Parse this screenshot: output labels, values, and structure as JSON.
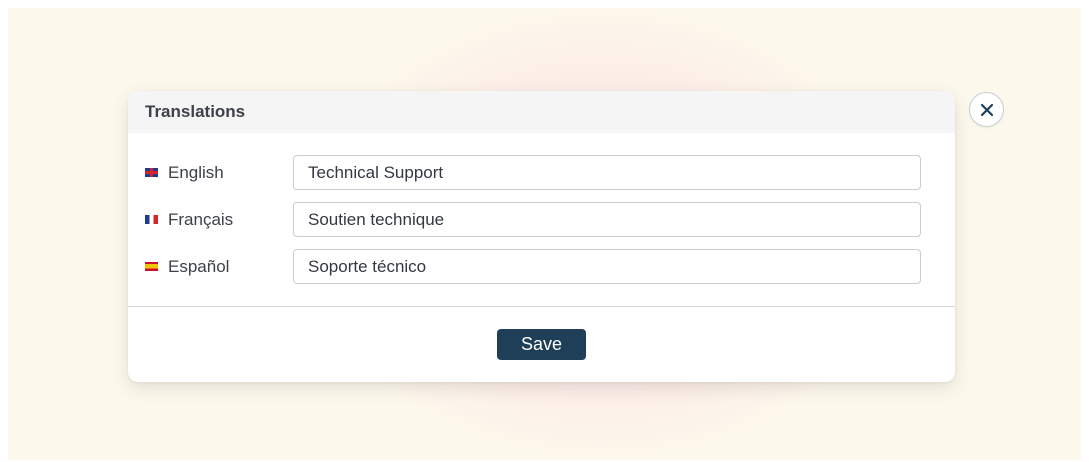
{
  "modal": {
    "title": "Translations",
    "rows": [
      {
        "flag_icon": "uk-flag-icon",
        "language": "English",
        "value": "Technical Support"
      },
      {
        "flag_icon": "france-flag-icon",
        "language": "Français",
        "value": "Soutien technique"
      },
      {
        "flag_icon": "spain-flag-icon",
        "language": "Español",
        "value": "Soporte técnico"
      }
    ],
    "save_label": "Save",
    "close_icon": "close-icon"
  },
  "colors": {
    "background": "#fdf8ec",
    "header_bg": "#f5f5f5",
    "button_bg": "#1f3f59",
    "text": "#3d4149"
  }
}
